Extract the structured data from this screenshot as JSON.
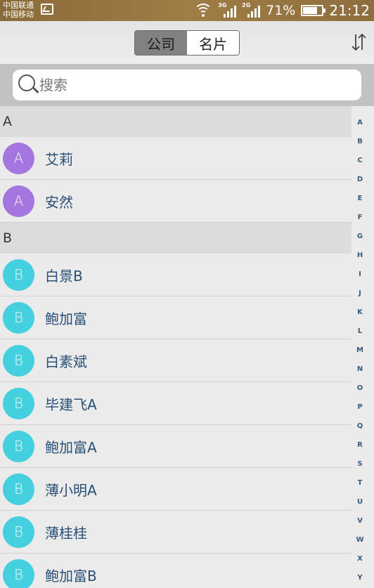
{
  "status_bar": {
    "carrier1": "中国联通",
    "carrier2": "中国移动",
    "net1": "3G",
    "net2": "2G",
    "battery": "71%",
    "time": "21:12"
  },
  "header": {
    "tabs": [
      {
        "label": "公司",
        "active": true
      },
      {
        "label": "名片",
        "active": false
      }
    ],
    "sort_icon": "sort-arrows-icon"
  },
  "search": {
    "placeholder": "搜索"
  },
  "sections": [
    {
      "letter": "A",
      "contacts": [
        {
          "initial": "A",
          "name": "艾莉"
        },
        {
          "initial": "A",
          "name": "安然"
        }
      ]
    },
    {
      "letter": "B",
      "contacts": [
        {
          "initial": "B",
          "name": "白景B"
        },
        {
          "initial": "B",
          "name": "鲍加富"
        },
        {
          "initial": "B",
          "name": "白素斌"
        },
        {
          "initial": "B",
          "name": "毕建飞A"
        },
        {
          "initial": "B",
          "name": "鲍加富A"
        },
        {
          "initial": "B",
          "name": "薄小明A"
        },
        {
          "initial": "B",
          "name": "薄桂桂"
        },
        {
          "initial": "B",
          "name": "鲍加富B"
        }
      ]
    }
  ],
  "index_letters": [
    "A",
    "B",
    "C",
    "D",
    "E",
    "F",
    "G",
    "H",
    "I",
    "J",
    "K",
    "L",
    "M",
    "N",
    "O",
    "P",
    "Q",
    "R",
    "S",
    "T",
    "U",
    "V",
    "W",
    "X",
    "Y"
  ],
  "colors": {
    "avatar_a": "#a575e0",
    "avatar_b": "#44d0de",
    "name_text": "#2a4f76",
    "status_bar": "#a07d46"
  }
}
